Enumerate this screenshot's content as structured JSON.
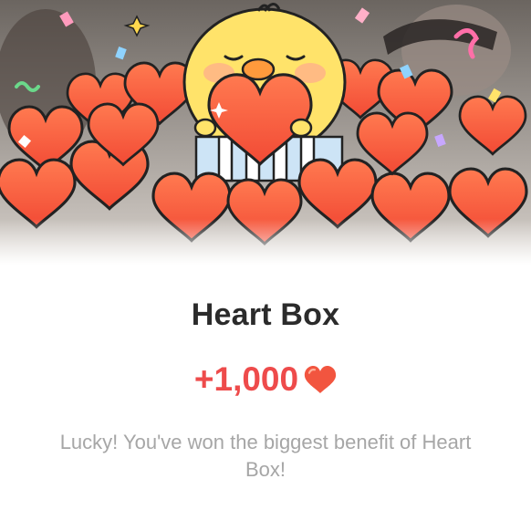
{
  "dialog": {
    "title": "Heart Box",
    "reward_amount": "+1,000",
    "reward_icon": "heart-icon",
    "message": "Lucky! You've won the biggest benefit of Heart Box!"
  },
  "colors": {
    "heart": "#f2553f",
    "heart_light": "#ff8a62",
    "reward_text": "#ee4b4b",
    "title_text": "#2b2b2b",
    "message_text": "#a6a6a6",
    "chick": "#ffe36a"
  }
}
